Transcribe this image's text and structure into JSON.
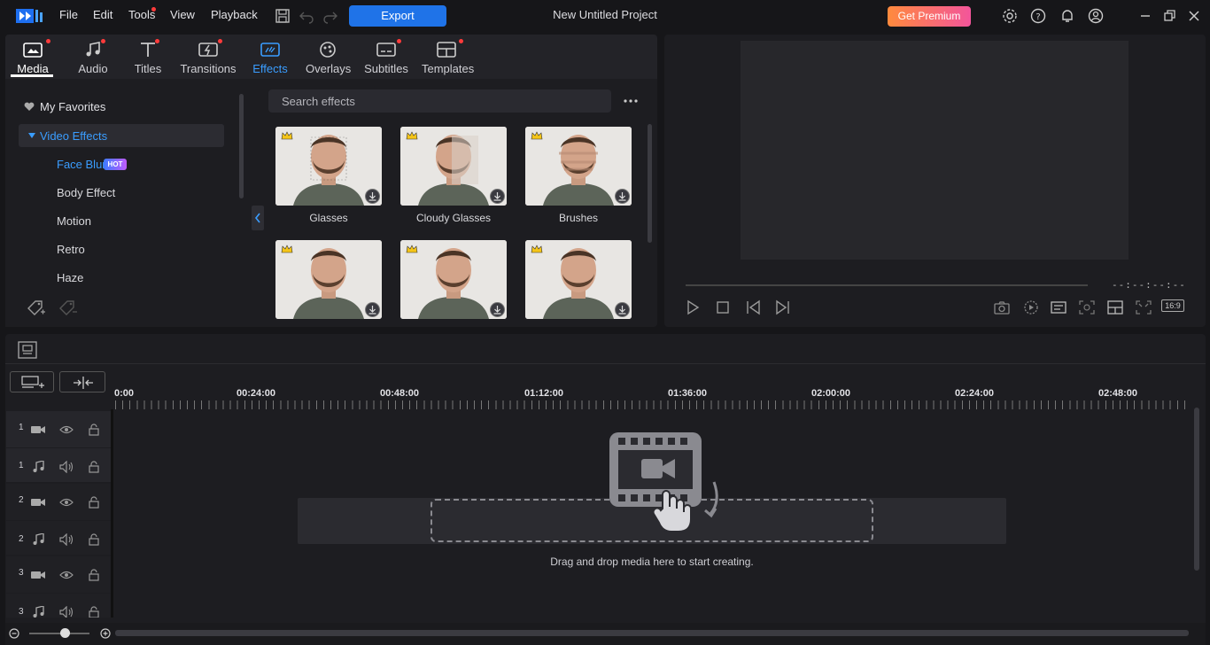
{
  "menu": {
    "items": [
      "File",
      "Edit",
      "Tools",
      "View",
      "Playback"
    ],
    "export_label": "Export",
    "project_title": "New Untitled Project",
    "premium_label": "Get Premium"
  },
  "library": {
    "tabs": [
      {
        "label": "Media",
        "icon": "media-icon",
        "dot": true
      },
      {
        "label": "Audio",
        "icon": "music-note-icon",
        "dot": true
      },
      {
        "label": "Titles",
        "icon": "title-t-icon",
        "dot": true
      },
      {
        "label": "Transitions",
        "icon": "transition-icon",
        "dot": true
      },
      {
        "label": "Effects",
        "icon": "effects-icon",
        "dot": false
      },
      {
        "label": "Overlays",
        "icon": "overlays-icon",
        "dot": false
      },
      {
        "label": "Subtitles",
        "icon": "subtitles-icon",
        "dot": true
      },
      {
        "label": "Templates",
        "icon": "templates-icon",
        "dot": true
      }
    ],
    "categories": {
      "favorites": "My Favorites",
      "group": "Video Effects",
      "items": [
        "Face Blur",
        "Body Effect",
        "Motion",
        "Retro",
        "Haze"
      ],
      "hot_badge": "HOT"
    },
    "search_placeholder": "Search effects",
    "effects": [
      {
        "label": "Glasses"
      },
      {
        "label": "Cloudy Glasses"
      },
      {
        "label": "Brushes"
      },
      {
        "label": ""
      },
      {
        "label": ""
      },
      {
        "label": ""
      }
    ]
  },
  "preview": {
    "timecode": "--:--:--:--",
    "aspect_ratio": "16:9"
  },
  "timeline": {
    "ruler": [
      "0:00",
      "00:24:00",
      "00:48:00",
      "01:12:00",
      "01:36:00",
      "02:00:00",
      "02:24:00",
      "02:48:00"
    ],
    "tracks": [
      {
        "num": "1",
        "type": "video"
      },
      {
        "num": "1",
        "type": "audio"
      },
      {
        "num": "2",
        "type": "video"
      },
      {
        "num": "2",
        "type": "audio"
      },
      {
        "num": "3",
        "type": "video"
      },
      {
        "num": "3",
        "type": "audio"
      }
    ],
    "drop_text": "Drag and drop media here to start creating."
  }
}
